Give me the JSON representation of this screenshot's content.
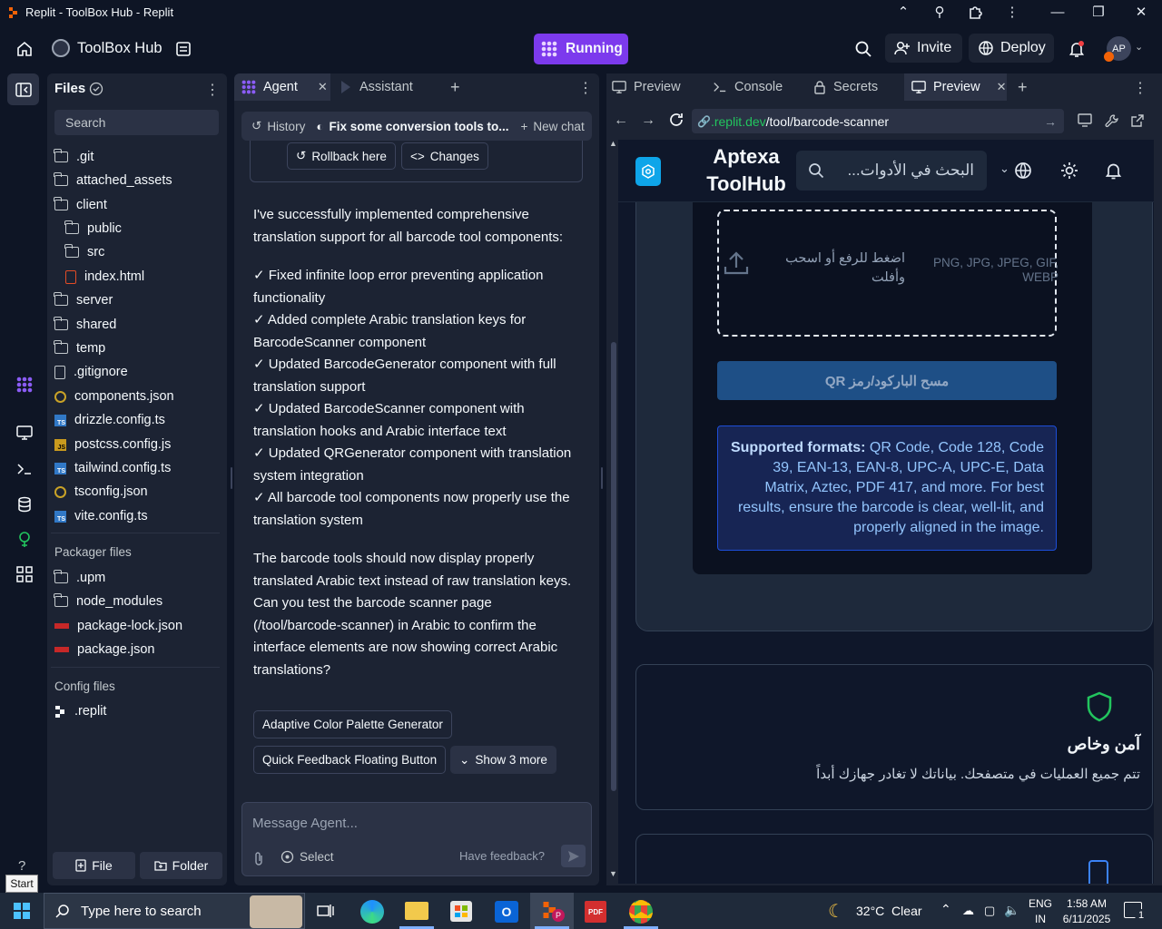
{
  "window": {
    "title": "Replit - ToolBox Hub - Replit"
  },
  "topbar": {
    "project_name": "ToolBox Hub",
    "run_label": "Running",
    "invite_label": "Invite",
    "deploy_label": "Deploy",
    "avatar_initials": "AP"
  },
  "files": {
    "title": "Files",
    "search_placeholder": "Search",
    "items": [
      ".git",
      "attached_assets",
      "client",
      "public",
      "src",
      "index.html",
      "server",
      "shared",
      "temp",
      ".gitignore",
      "components.json",
      "drizzle.config.ts",
      "postcss.config.js",
      "tailwind.config.ts",
      "tsconfig.json",
      "vite.config.ts"
    ],
    "packager_heading": "Packager files",
    "packager_items": [
      ".upm",
      "node_modules",
      "package-lock.json",
      "package.json"
    ],
    "config_heading": "Config files",
    "config_items": [
      ".replit"
    ],
    "file_button": "File",
    "folder_button": "Folder"
  },
  "agent": {
    "tabs": [
      "Agent",
      "Assistant"
    ],
    "history_label": "History",
    "current_chat": "Fix some conversion tools to...",
    "new_chat_label": "New chat",
    "rollback_label": "Rollback here",
    "changes_label": "Changes",
    "message_intro": "I've successfully implemented comprehensive translation support for all barcode tool components:",
    "message_items": [
      "✓ Fixed infinite loop error preventing application functionality",
      "✓ Added complete Arabic translation keys for BarcodeScanner component",
      "✓ Updated BarcodeGenerator component with full translation support",
      "✓ Updated BarcodeScanner component with translation hooks and Arabic interface text",
      "✓ Updated QRGenerator component with translation system integration",
      "✓ All barcode tool components now properly use the translation system"
    ],
    "message_outro": "The barcode tools should now display properly translated Arabic text instead of raw translation keys. Can you test the barcode scanner page (/tool/barcode-scanner) in Arabic to confirm the interface elements are now showing correct Arabic translations?",
    "suggestions": [
      "Adaptive Color Palette Generator",
      "Quick Feedback Floating Button"
    ],
    "show_more_label": "Show 3 more",
    "input_placeholder": "Message Agent...",
    "select_label": "Select",
    "feedback_label": "Have feedback?"
  },
  "preview": {
    "tabs": [
      "Preview",
      "Console",
      "Secrets",
      "Preview"
    ],
    "url_domain": ".replit.dev",
    "url_path": "/tool/barcode-scanner",
    "site": {
      "brand_line1": "Aptexa",
      "brand_line2": "ToolHub",
      "search_placeholder": "البحث في الأدوات...",
      "upload_text_1": "اضغط للرفع أو اسحب",
      "upload_text_2": "وأفلت",
      "formats_1": "PNG, JPG, JPEG, GIF,",
      "formats_2": "WEBP",
      "scan_button": "مسح الباركود/رمز QR",
      "supported_label": "Supported formats:",
      "supported_text": " QR Code, Code 128, Code 39, EAN-13, EAN-8, UPC-A, UPC-E, Data Matrix, Aztec, PDF 417, and more. For best results, ensure the barcode is clear, well-lit, and properly aligned in the image.",
      "secure_title": "آمن وخاص",
      "secure_desc": "تتم جميع العمليات في متصفحك. بياناتك لا تغادر جهازك أبداً"
    }
  },
  "taskbar": {
    "start_tooltip": "Start",
    "search_placeholder": "Type here to search",
    "weather": "32°C  Clear",
    "lang_1": "ENG",
    "lang_2": "IN",
    "time": "1:58 AM",
    "date": "6/11/2025",
    "notifications": "1"
  },
  "colors": {
    "accent": "#0079f2",
    "running": "#7c3aed",
    "site_primary": "#2563eb",
    "site_button": "#1e4f86"
  }
}
